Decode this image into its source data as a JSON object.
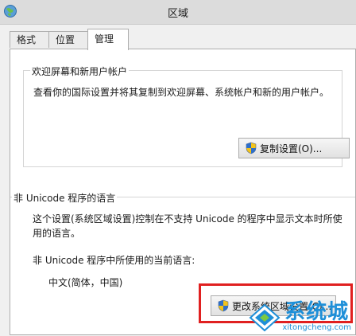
{
  "window": {
    "title": "区域",
    "icon": "globe-icon"
  },
  "tabs": [
    {
      "label": "格式",
      "active": false
    },
    {
      "label": "位置",
      "active": false
    },
    {
      "label": "管理",
      "active": true
    }
  ],
  "welcome_group": {
    "title": "欢迎屏幕和新用户帐户",
    "description": "查看你的国际设置并将其复制到欢迎屏幕、系统帐户和新的用户帐户。",
    "copy_button": {
      "label": "复制设置(O)...",
      "icon": "uac-shield-icon"
    }
  },
  "nonunicode_group": {
    "title": "非 Unicode 程序的语言",
    "description_line1": "这个设置(系统区域设置)控制在不支持 Unicode 的程序中显示文本时所使",
    "description_line2": "用的语言。",
    "current_label": "非 Unicode 程序中所使用的当前语言:",
    "current_value": "中文(简体，中国)",
    "change_button": {
      "label": "更改系统区域设置(C)...",
      "icon": "uac-shield-icon"
    }
  },
  "watermark": {
    "text_cn": "系统城",
    "text_en": "xitongcheng.com"
  },
  "colors": {
    "highlight": "#e02020",
    "watermark": "#1e8fd8"
  }
}
